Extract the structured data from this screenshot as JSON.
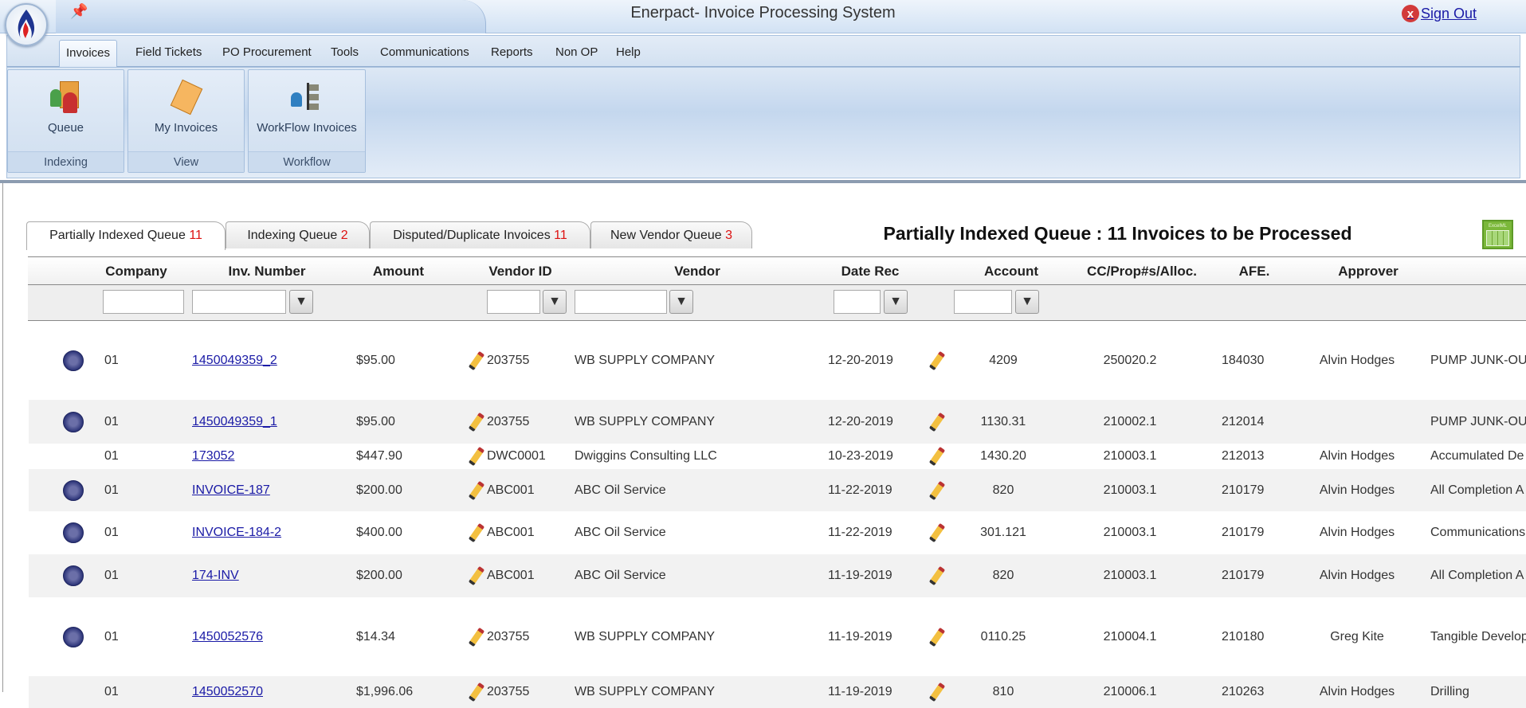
{
  "app": {
    "title": "Enerpact- Invoice Processing System",
    "sign_out": "Sign Out"
  },
  "menu": [
    "Invoices",
    "Field Tickets",
    "PO Procurement",
    "Tools",
    "Communications",
    "Reports",
    "Non OP",
    "Help"
  ],
  "ribbon": [
    {
      "button": "Queue",
      "group": "Indexing",
      "icon": "queue-icon"
    },
    {
      "button": "My Invoices",
      "group": "View",
      "icon": "calculator-icon"
    },
    {
      "button": "WorkFlow Invoices",
      "group": "Workflow",
      "icon": "workflow-icon"
    }
  ],
  "queue_tabs": [
    {
      "label": "Partially Indexed Queue",
      "count": "11"
    },
    {
      "label": "Indexing Queue",
      "count": "2"
    },
    {
      "label": "Disputed/Duplicate Invoices",
      "count": "11"
    },
    {
      "label": "New Vendor Queue",
      "count": "3"
    }
  ],
  "heading": "Partially Indexed Queue : 11 Invoices to be Processed",
  "export_label": "ExcelML",
  "columns": [
    "Company",
    "Inv. Number",
    "Amount",
    "Vendor ID",
    "Vendor",
    "Date Rec",
    "Account",
    "CC/Prop#s/Alloc.",
    "AFE.",
    "Approver"
  ],
  "rows": [
    {
      "icon": true,
      "company": "01",
      "inv": "1450049359_2",
      "amount": "$95.00",
      "vendor_id": "203755",
      "vendor": "WB SUPPLY COMPANY",
      "date": "12-20-2019",
      "account": "4209",
      "cc": "250020.2",
      "afe": "184030",
      "approver": "Alvin Hodges",
      "desc": "PUMP JUNK-OU"
    },
    {
      "icon": true,
      "company": "01",
      "inv": "1450049359_1",
      "amount": "$95.00",
      "vendor_id": "203755",
      "vendor": "WB SUPPLY COMPANY",
      "date": "12-20-2019",
      "account": "1130.31",
      "cc": "210002.1",
      "afe": "212014",
      "approver": "",
      "desc": "PUMP JUNK-OU"
    },
    {
      "icon": false,
      "company": "01",
      "inv": "173052",
      "amount": "$447.90",
      "vendor_id": "DWC0001",
      "vendor": "Dwiggins Consulting LLC",
      "date": "10-23-2019",
      "account": "1430.20",
      "cc": "210003.1",
      "afe": "212013",
      "approver": "Alvin Hodges",
      "desc": "Accumulated De"
    },
    {
      "icon": true,
      "company": "01",
      "inv": "INVOICE-187",
      "amount": "$200.00",
      "vendor_id": "ABC001",
      "vendor": "ABC Oil Service",
      "date": "11-22-2019",
      "account": "820",
      "cc": "210003.1",
      "afe": "210179",
      "approver": "Alvin Hodges",
      "desc": "All Completion A"
    },
    {
      "icon": true,
      "company": "01",
      "inv": "INVOICE-184-2",
      "amount": "$400.00",
      "vendor_id": "ABC001",
      "vendor": "ABC Oil Service",
      "date": "11-22-2019",
      "account": "301.121",
      "cc": "210003.1",
      "afe": "210179",
      "approver": "Alvin Hodges",
      "desc": "Communications"
    },
    {
      "icon": true,
      "company": "01",
      "inv": "174-INV",
      "amount": "$200.00",
      "vendor_id": "ABC001",
      "vendor": "ABC Oil Service",
      "date": "11-19-2019",
      "account": "820",
      "cc": "210003.1",
      "afe": "210179",
      "approver": "Alvin Hodges",
      "desc": "All Completion A"
    },
    {
      "icon": true,
      "company": "01",
      "inv": "1450052576",
      "amount": "$14.34",
      "vendor_id": "203755",
      "vendor": "WB SUPPLY COMPANY",
      "date": "11-19-2019",
      "account": "0110.25",
      "cc": "210004.1",
      "afe": "210180",
      "approver": "Greg Kite",
      "desc": "Tangible Develop"
    },
    {
      "icon": false,
      "company": "01",
      "inv": "1450052570",
      "amount": "$1,996.06",
      "vendor_id": "203755",
      "vendor": "WB SUPPLY COMPANY",
      "date": "11-19-2019",
      "account": "810",
      "cc": "210006.1",
      "afe": "210263",
      "approver": "Alvin Hodges",
      "desc": "Drilling"
    }
  ]
}
